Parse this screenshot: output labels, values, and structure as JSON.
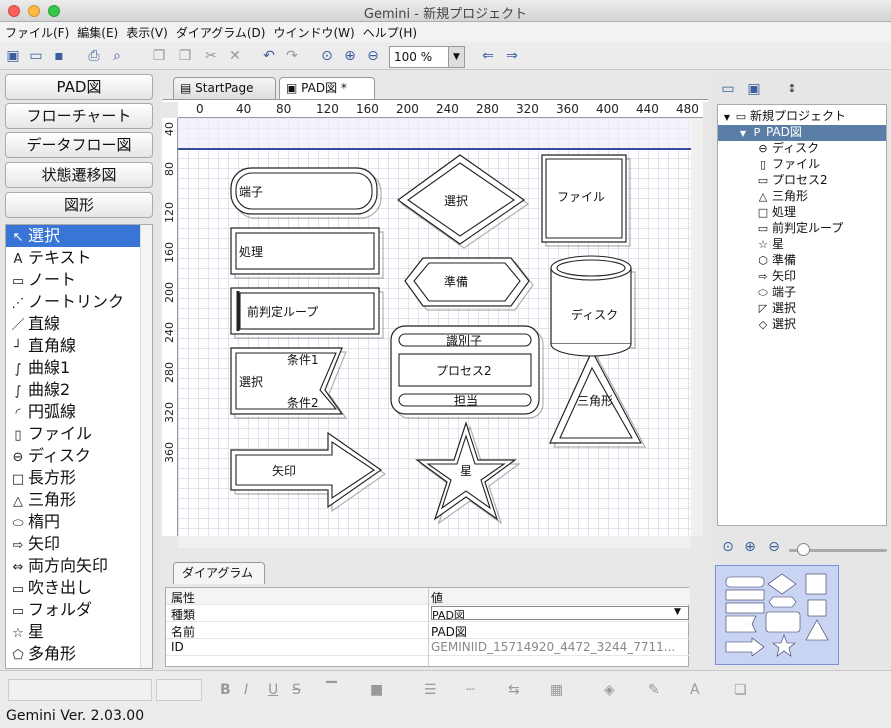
{
  "window": {
    "title": "Gemini - 新規プロジェクト"
  },
  "menu": [
    "ファイル(F)",
    "編集(E)",
    "表示(V)",
    "ダイアグラム(D)",
    "ウインドウ(W)",
    "ヘルプ(H)"
  ],
  "toolbar": {
    "zoom": "100 %"
  },
  "categories": [
    "PAD図",
    "フローチャート",
    "データフロー図",
    "状態遷移図",
    "図形"
  ],
  "tools": [
    {
      "icon": "cursor-icon",
      "glyph": "↖",
      "label": "選択"
    },
    {
      "icon": "text-icon",
      "glyph": "A",
      "label": "テキスト"
    },
    {
      "icon": "note-icon",
      "glyph": "▭",
      "label": "ノート"
    },
    {
      "icon": "note-link-icon",
      "glyph": "⋰",
      "label": "ノートリンク"
    },
    {
      "icon": "line-icon",
      "glyph": "／",
      "label": "直線"
    },
    {
      "icon": "right-angle-line-icon",
      "glyph": "┘",
      "label": "直角線"
    },
    {
      "icon": "curve1-icon",
      "glyph": "∫",
      "label": "曲線1"
    },
    {
      "icon": "curve2-icon",
      "glyph": "∫",
      "label": "曲線2"
    },
    {
      "icon": "arc-line-icon",
      "glyph": "◜",
      "label": "円弧線"
    },
    {
      "icon": "file-icon",
      "glyph": "▯",
      "label": "ファイル"
    },
    {
      "icon": "disk-icon",
      "glyph": "⊖",
      "label": "ディスク"
    },
    {
      "icon": "rectangle-icon",
      "glyph": "□",
      "label": "長方形"
    },
    {
      "icon": "triangle-icon",
      "glyph": "△",
      "label": "三角形"
    },
    {
      "icon": "ellipse-icon",
      "glyph": "⬭",
      "label": "楕円"
    },
    {
      "icon": "arrow-icon",
      "glyph": "⇨",
      "label": "矢印"
    },
    {
      "icon": "double-arrow-icon",
      "glyph": "⇔",
      "label": "両方向矢印"
    },
    {
      "icon": "balloon-icon",
      "glyph": "▭",
      "label": "吹き出し"
    },
    {
      "icon": "folder-icon",
      "glyph": "▭",
      "label": "フォルダ"
    },
    {
      "icon": "star-icon",
      "glyph": "☆",
      "label": "星"
    },
    {
      "icon": "polygon-icon",
      "glyph": "⬠",
      "label": "多角形"
    }
  ],
  "tabs": [
    "StartPage",
    "PAD図 *"
  ],
  "ruler": {
    "top": [
      "0",
      "40",
      "80",
      "120",
      "160",
      "200",
      "240",
      "280",
      "320",
      "360",
      "400",
      "440",
      "480"
    ],
    "left": [
      "40",
      "80",
      "120",
      "160",
      "200",
      "240",
      "280",
      "320",
      "360"
    ]
  },
  "shapes": {
    "terminal": "端子",
    "process": "処理",
    "pre_loop": "前判定ループ",
    "select": "選択",
    "cond1": "条件1",
    "cond2": "条件2",
    "arrow": "矢印",
    "diamond_select": "選択",
    "prepare": "準備",
    "identifier": "識別子",
    "process2": "プロセス2",
    "owner": "担当",
    "star": "星",
    "file": "ファイル",
    "disk": "ディスク",
    "triangle": "三角形"
  },
  "properties": {
    "tab": "ダイアグラム",
    "headers": [
      "属性",
      "値"
    ],
    "rows": [
      {
        "key": "種類",
        "value": "PAD図"
      },
      {
        "key": "名前",
        "value": "PAD図"
      },
      {
        "key": "ID",
        "value": "GEMINIID_15714920_4472_3244_7711..."
      }
    ]
  },
  "tree": [
    {
      "level": 0,
      "icon": "folder-icon",
      "glyph": "▭",
      "label": "新規プロジェクト",
      "expander": "▼"
    },
    {
      "level": 1,
      "icon": "diagram-icon",
      "glyph": "P",
      "label": "PAD図",
      "expander": "▼",
      "selected": true
    },
    {
      "level": 2,
      "icon": "disk-icon",
      "glyph": "⊖",
      "label": "ディスク"
    },
    {
      "level": 2,
      "icon": "file-icon",
      "glyph": "▯",
      "label": "ファイル"
    },
    {
      "level": 2,
      "icon": "process2-icon",
      "glyph": "▭",
      "label": "プロセス2"
    },
    {
      "level": 2,
      "icon": "triangle-icon",
      "glyph": "△",
      "label": "三角形"
    },
    {
      "level": 2,
      "icon": "rectangle-icon",
      "glyph": "□",
      "label": "処理"
    },
    {
      "level": 2,
      "icon": "loop-icon",
      "glyph": "▭",
      "label": "前判定ループ"
    },
    {
      "level": 2,
      "icon": "star-icon",
      "glyph": "☆",
      "label": "星"
    },
    {
      "level": 2,
      "icon": "hexagon-icon",
      "glyph": "⬡",
      "label": "準備"
    },
    {
      "level": 2,
      "icon": "arrow-icon",
      "glyph": "⇨",
      "label": "矢印"
    },
    {
      "level": 2,
      "icon": "ellipse-icon",
      "glyph": "⬭",
      "label": "端子"
    },
    {
      "level": 2,
      "icon": "select-icon",
      "glyph": "◸",
      "label": "選択"
    },
    {
      "level": 2,
      "icon": "diamond-icon",
      "glyph": "◇",
      "label": "選択"
    }
  ],
  "status": "Gemini  Ver. 2.03.00"
}
